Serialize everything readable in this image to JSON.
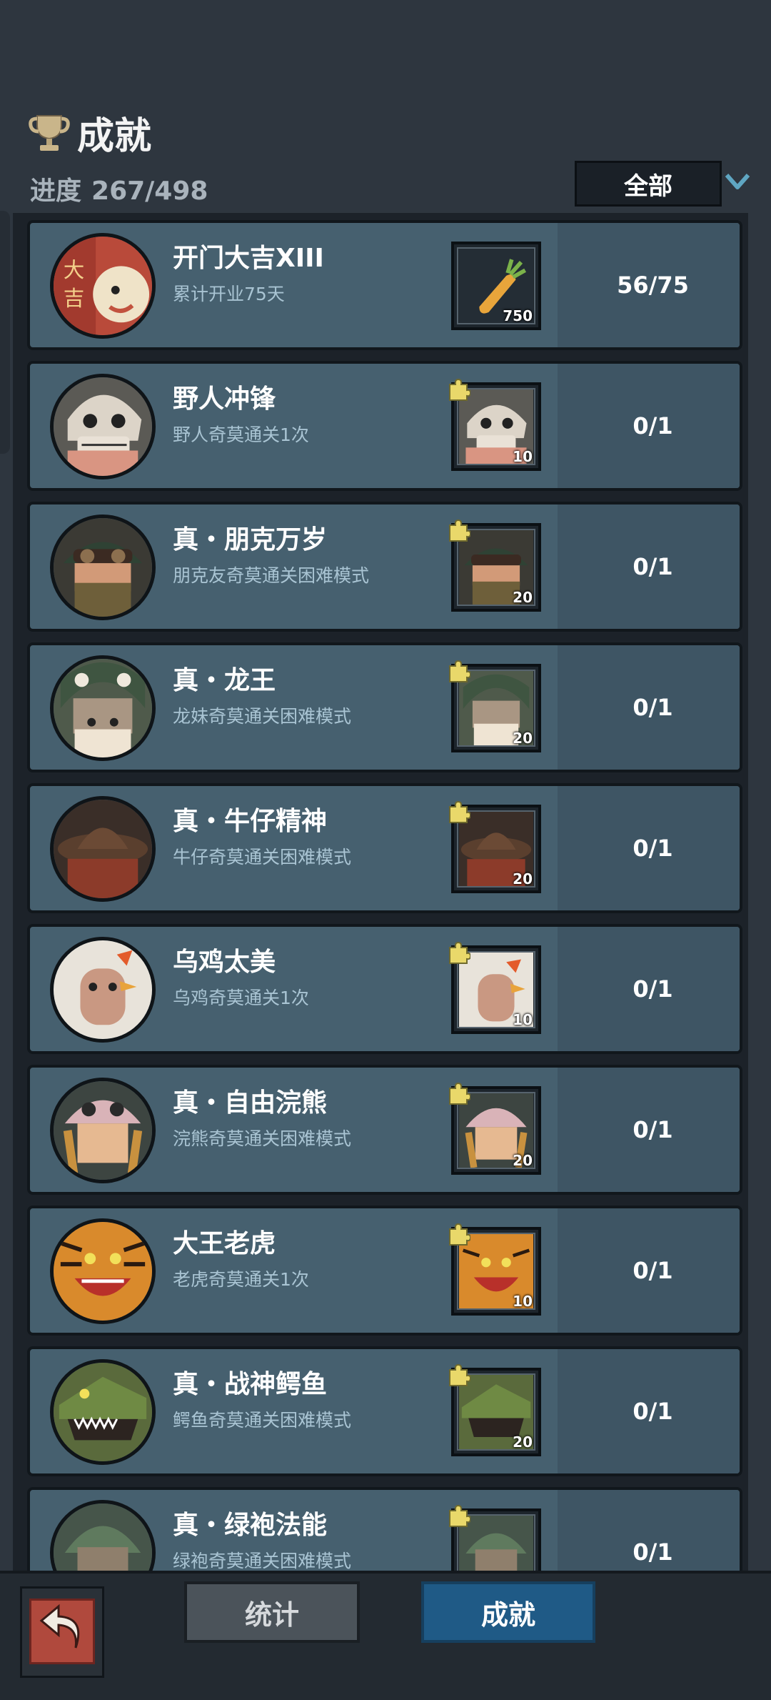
{
  "header": {
    "title": "成就",
    "progress_label": "进度",
    "progress_value": "267/498",
    "filter_label": "全部"
  },
  "achievements": [
    {
      "name": "开门大吉XIII",
      "desc": "累计开业75天",
      "reward_qty": "750",
      "count": "56/75"
    },
    {
      "name": "野人冲锋",
      "desc": "野人奇莫通关1次",
      "reward_qty": "10",
      "count": "0/1"
    },
    {
      "name": "真・朋克万岁",
      "desc": "朋克友奇莫通关困难模式",
      "reward_qty": "20",
      "count": "0/1"
    },
    {
      "name": "真・龙王",
      "desc": "龙妹奇莫通关困难模式",
      "reward_qty": "20",
      "count": "0/1"
    },
    {
      "name": "真・牛仔精神",
      "desc": "牛仔奇莫通关困难模式",
      "reward_qty": "20",
      "count": "0/1"
    },
    {
      "name": "乌鸡太美",
      "desc": "乌鸡奇莫通关1次",
      "reward_qty": "10",
      "count": "0/1"
    },
    {
      "name": "真・自由浣熊",
      "desc": "浣熊奇莫通关困难模式",
      "reward_qty": "20",
      "count": "0/1"
    },
    {
      "name": "大王老虎",
      "desc": "老虎奇莫通关1次",
      "reward_qty": "10",
      "count": "0/1"
    },
    {
      "name": "真・战神鳄鱼",
      "desc": "鳄鱼奇莫通关困难模式",
      "reward_qty": "20",
      "count": "0/1"
    },
    {
      "name": "真・绿袍法能",
      "desc": "绿袍奇莫通关困难模式",
      "reward_qty": "",
      "count": "0/1"
    }
  ],
  "footer": {
    "tab_stats": "统计",
    "tab_achievements": "成就"
  },
  "colors": {
    "card": "#46606f",
    "card_border": "#11171c",
    "active_tab": "#1f5a86",
    "back_button": "#b0493d",
    "puzzle_badge": "#e9d86a"
  },
  "icons": {
    "title": "trophy-icon",
    "filter": "chevron-down-icon",
    "back": "return-arrow-icon",
    "reward_badge": "puzzle-piece-icon",
    "first_reward": "carrot-icon"
  }
}
